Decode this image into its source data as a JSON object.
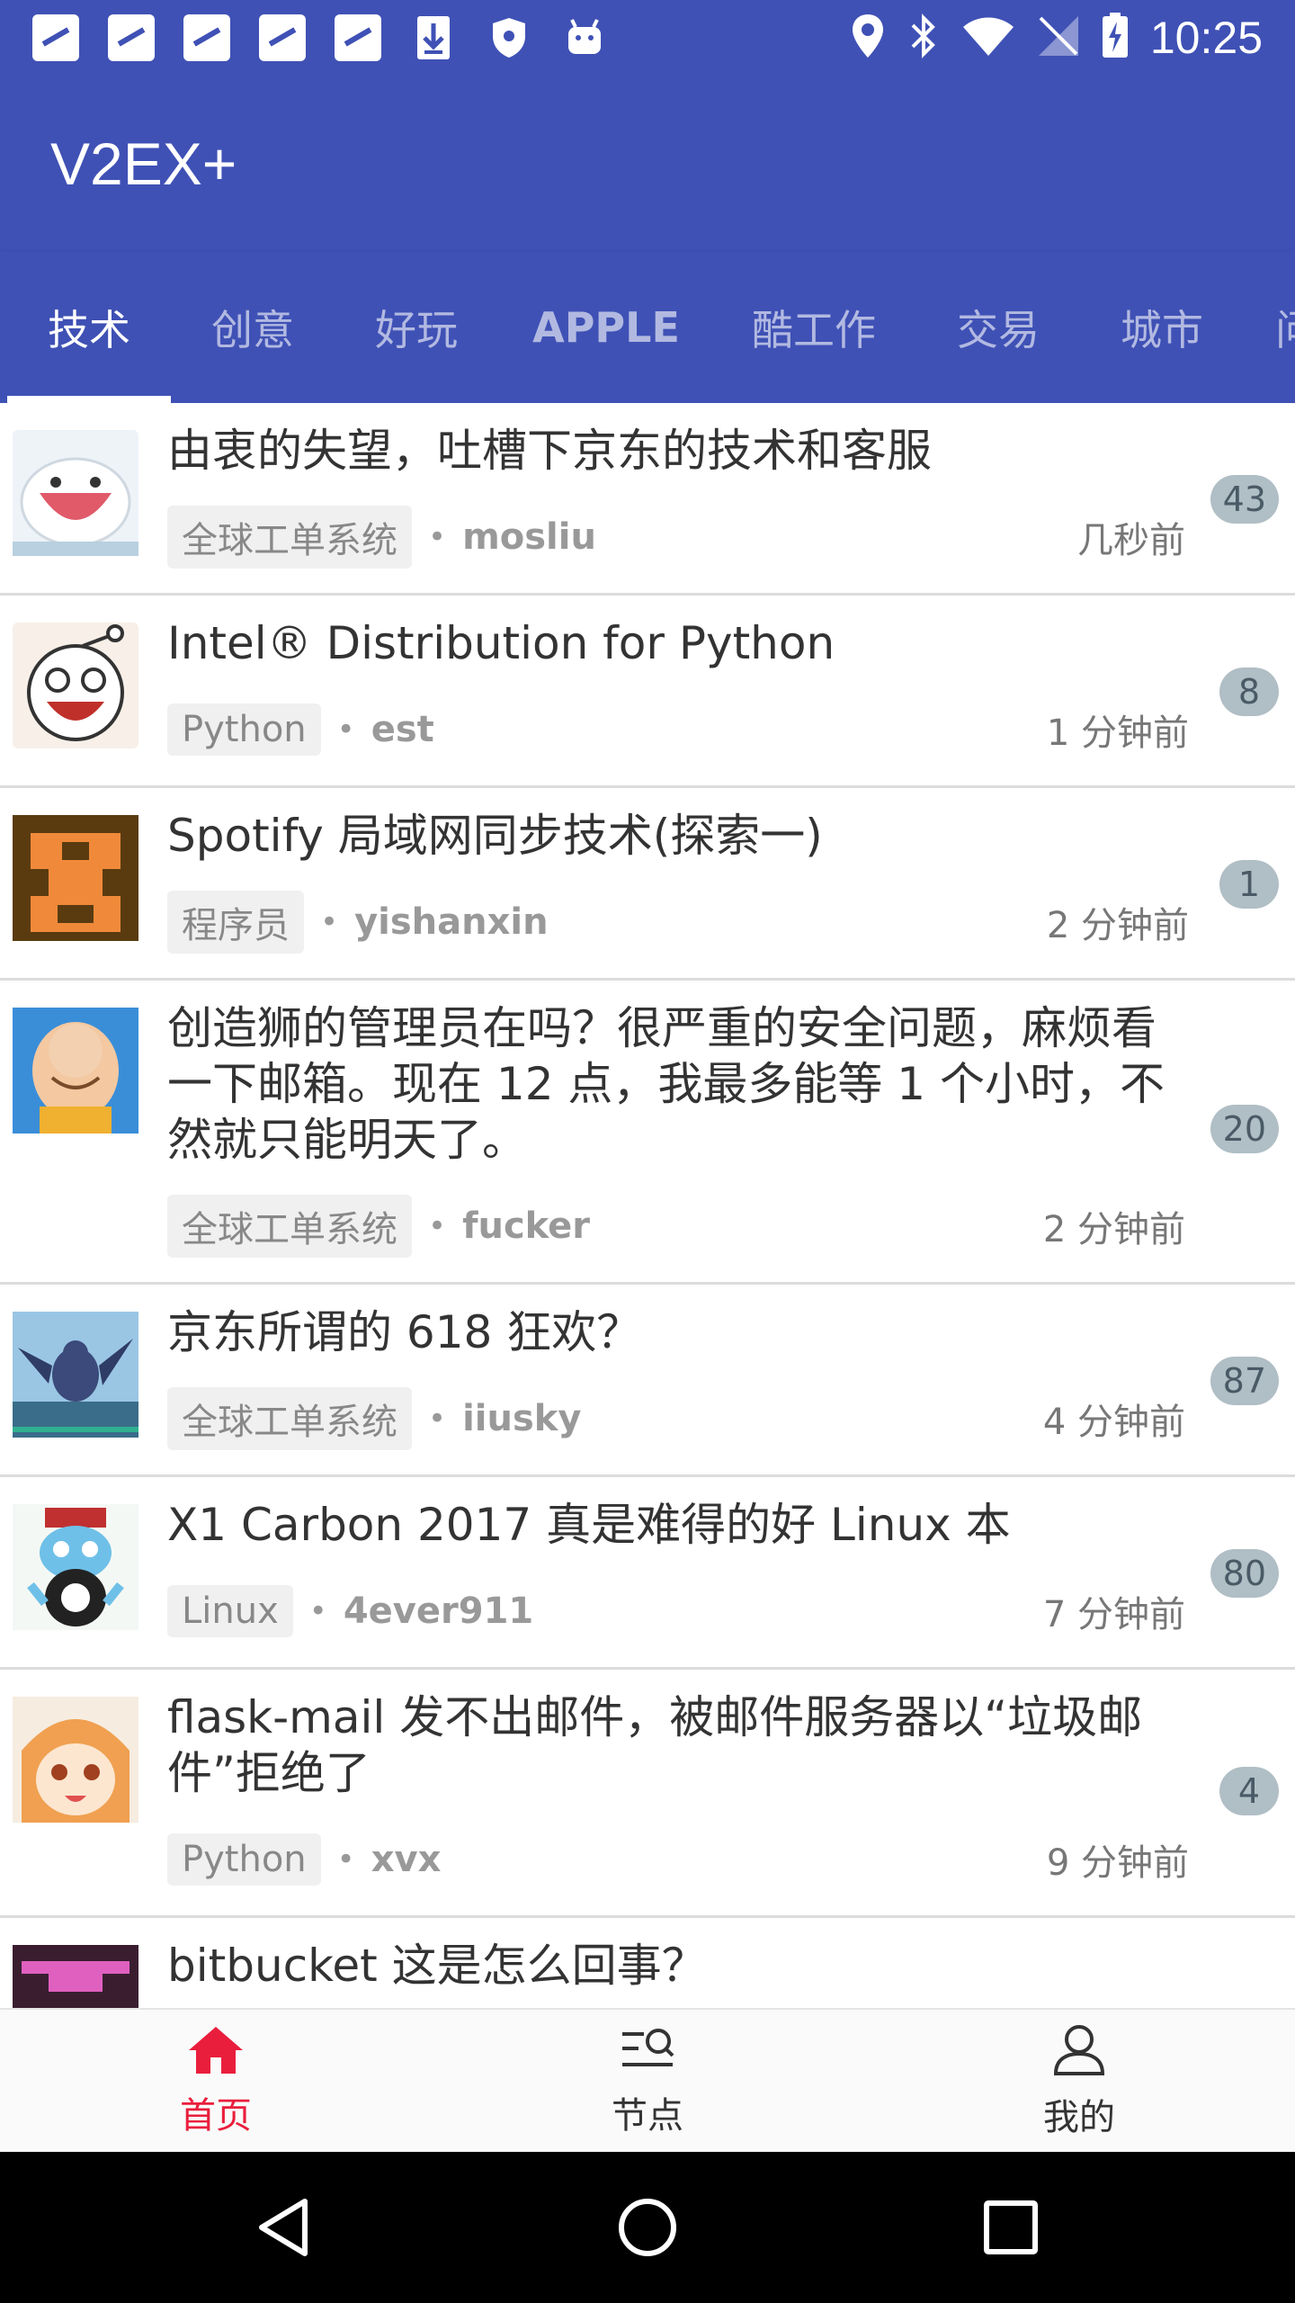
{
  "status_bar": {
    "time": "10:25",
    "left_icons": [
      "notification-icon",
      "notification-icon",
      "notification-icon",
      "notification-icon",
      "notification-icon",
      "download-icon",
      "shield-icon",
      "android-icon"
    ],
    "right_icons": [
      "location-icon",
      "bluetooth-icon",
      "wifi-icon",
      "no-sim-icon",
      "battery-charging-icon"
    ]
  },
  "app": {
    "title": "V2EX+",
    "primary_color": "#3f51b5",
    "accent_color": "#e91e3c"
  },
  "tabs": [
    {
      "label": "技术",
      "active": true
    },
    {
      "label": "创意",
      "active": false
    },
    {
      "label": "好玩",
      "active": false
    },
    {
      "label": "APPLE",
      "active": false
    },
    {
      "label": "酷工作",
      "active": false
    },
    {
      "label": "交易",
      "active": false
    },
    {
      "label": "城市",
      "active": false
    }
  ],
  "topics": [
    {
      "title": "由衷的失望，吐槽下京东的技术和客服",
      "node": "全球工单系统",
      "author": "mosliu",
      "time": "几秒前",
      "replies": "43"
    },
    {
      "title": "Intel® Distribution for Python",
      "node": "Python",
      "author": "est",
      "time": "1 分钟前",
      "replies": "8"
    },
    {
      "title": "Spotify 局域网同步技术(探索一)",
      "node": "程序员",
      "author": "yishanxin",
      "time": "2 分钟前",
      "replies": "1"
    },
    {
      "title": "创造狮的管理员在吗？很严重的安全问题，麻烦看一下邮箱。现在 12 点，我最多能等 1 个小时，不然就只能明天了。",
      "node": "全球工单系统",
      "author": "fucker",
      "time": "2 分钟前",
      "replies": "20"
    },
    {
      "title": "京东所谓的 618 狂欢？",
      "node": "全球工单系统",
      "author": "iiusky",
      "time": "4 分钟前",
      "replies": "87"
    },
    {
      "title": "X1 Carbon 2017 真是难得的好 Linux 本",
      "node": "Linux",
      "author": "4ever911",
      "time": "7 分钟前",
      "replies": "80"
    },
    {
      "title": "flask-mail 发不出邮件，被邮件服务器以“垃圾邮件”拒绝了",
      "node": "Python",
      "author": "xvx",
      "time": "9 分钟前",
      "replies": "4"
    },
    {
      "title": "bitbucket 这是怎么回事？",
      "node": "",
      "author": "",
      "time": "",
      "replies": ""
    }
  ],
  "bottom_nav": [
    {
      "label": "首页",
      "icon": "home-icon",
      "active": true
    },
    {
      "label": "节点",
      "icon": "nodes-icon",
      "active": false
    },
    {
      "label": "我的",
      "icon": "profile-icon",
      "active": false
    }
  ],
  "system_nav": [
    "back-icon",
    "home-circle-icon",
    "recents-icon"
  ]
}
